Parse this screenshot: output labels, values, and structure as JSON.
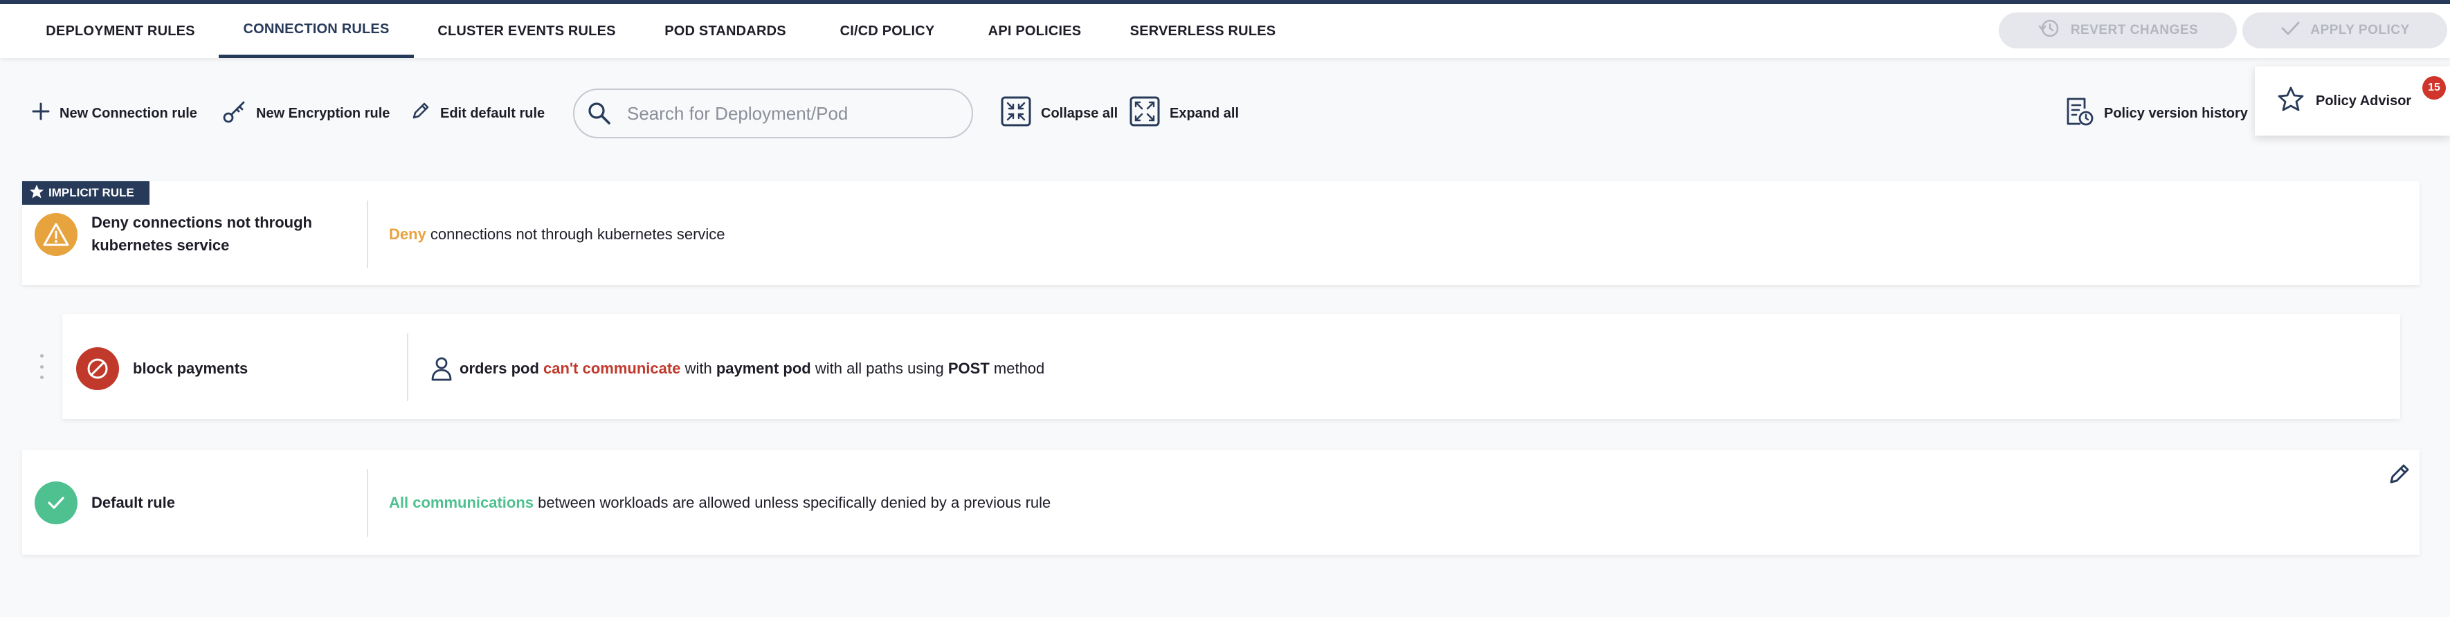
{
  "tabs": [
    {
      "label": "DEPLOYMENT RULES"
    },
    {
      "label": "CONNECTION RULES"
    },
    {
      "label": "CLUSTER EVENTS RULES"
    },
    {
      "label": "POD STANDARDS"
    },
    {
      "label": "CI/CD POLICY"
    },
    {
      "label": "API POLICIES"
    },
    {
      "label": "SERVERLESS RULES"
    }
  ],
  "active_tab": "CONNECTION RULES",
  "header": {
    "revert_label": "REVERT CHANGES",
    "apply_label": "APPLY POLICY"
  },
  "toolbar": {
    "new_connection_label": "New Connection rule",
    "new_encryption_label": "New Encryption rule",
    "edit_default_label": "Edit default rule",
    "collapse_label": "Collapse all",
    "expand_label": "Expand all",
    "history_label": "Policy version history"
  },
  "search": {
    "placeholder": "Search for Deployment/Pod",
    "value": ""
  },
  "advisor": {
    "label": "Policy Advisor",
    "badge_count": "15"
  },
  "rules": {
    "implicit": {
      "tag": "IMPLICIT RULE",
      "name_line1": "Deny connections not through",
      "name_line2": "kubernetes service",
      "action": "Deny",
      "rest": "connections not through kubernetes service"
    },
    "block": {
      "name": "block payments",
      "source": "orders pod",
      "action": "can't communicate",
      "with": "with",
      "target": "payment pod",
      "paths": "with all paths using",
      "method": "POST",
      "method_suffix": "method"
    },
    "default": {
      "name": "Default rule",
      "action": "All communications",
      "rest": "between workloads are allowed unless specifically denied by a previous rule"
    }
  },
  "colors": {
    "accent": "#283a5a",
    "deny": "#e7a33e",
    "block": "#c0392b",
    "allow": "#4fc08f",
    "badge": "#d0352b"
  },
  "icons": {
    "implicit": "warning-icon",
    "block": "block-icon",
    "default": "check-icon"
  }
}
